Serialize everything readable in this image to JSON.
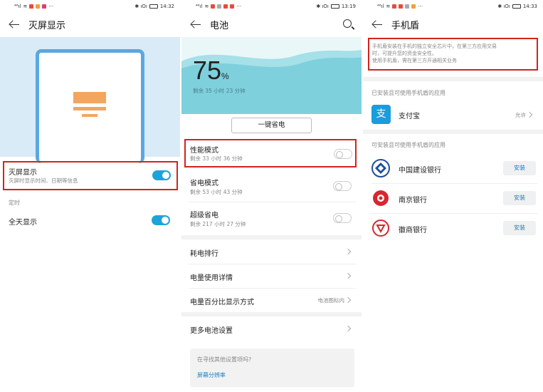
{
  "status": {
    "p1_time": "14:32",
    "p2_time": "13:19",
    "p3_time": "14:33",
    "signal_text": "⁴⁶ıl",
    "more": "···",
    "icons_right": "✱ ıOı"
  },
  "screen1": {
    "title": "灭屏显示",
    "aod_label": "灭屏显示",
    "aod_sub": "灭屏时显示时间、日期等信息",
    "section_timer": "定时",
    "all_day": "全天显示"
  },
  "screen2": {
    "title": "电池",
    "percent": "75",
    "percent_unit": "%",
    "remaining": "剩余 35 小时 23 分钟",
    "one_key_button": "一键省电",
    "perf_mode": "性能模式",
    "perf_sub": "剩余 33 小时 36 分钟",
    "save_mode": "省电模式",
    "save_sub": "剩余 53 小时 43 分钟",
    "ultra_mode": "超级省电",
    "ultra_sub": "剩余 217 小时 27 分钟",
    "rank": "耗电排行",
    "detail": "电量使用详情",
    "pct_display": "电量百分比显示方式",
    "pct_display_value": "电池图标内",
    "more_settings": "更多电池设置",
    "looking_for": "在寻找其他设置项吗?",
    "resolution_link": "屏幕分辨率"
  },
  "screen3": {
    "title": "手机盾",
    "desc_line1": "手机盾安装在手机的独立安全芯片中，在第三方应用交易",
    "desc_line2": "时，可提升您的资金安全性。",
    "desc_line3": "使用手机盾，需在第三方开通相关业务",
    "section_installed": "已安装且可使用手机盾的应用",
    "alipay": "支付宝",
    "alipay_status": "允许",
    "section_installable": "可安装且可使用手机盾的应用",
    "apps": [
      {
        "name": "中国建设银行",
        "action": "安装"
      },
      {
        "name": "南京银行",
        "action": "安装"
      },
      {
        "name": "徽商银行",
        "action": "安装"
      }
    ]
  },
  "colors": {
    "accent": "#1ca4d8",
    "highlight_red": "#d0241c",
    "wave": "#7ed0dd"
  }
}
